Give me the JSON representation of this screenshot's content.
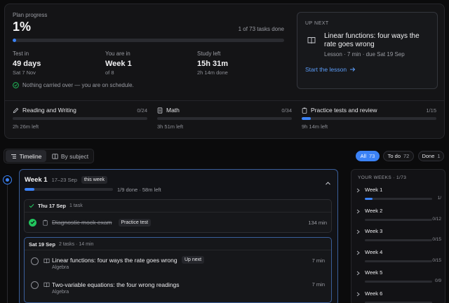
{
  "plan": {
    "label": "Plan progress",
    "percent_text": "1%",
    "tasks_done_text": "1 of 73 tasks done",
    "progress_fraction": 0.014
  },
  "stats": [
    {
      "label": "Test in",
      "value": "49 days",
      "sub": "Sat 7 Nov"
    },
    {
      "label": "You are in",
      "value": "Week 1",
      "sub": "of 8"
    },
    {
      "label": "Study left",
      "value": "15h 31m",
      "sub": "2h 14m done"
    }
  ],
  "schedule_note": "Nothing carried over — you are on schedule.",
  "up_next": {
    "label": "UP NEXT",
    "title": "Linear functions: four ways the rate goes wrong",
    "meta": "Lesson · 7 min · due Sat 19 Sep",
    "cta": "Start the lesson"
  },
  "categories": [
    {
      "name": "Reading and Writing",
      "count": "0/24",
      "left": "2h 26m left",
      "fraction": 0,
      "icon": "pencil-icon"
    },
    {
      "name": "Math",
      "count": "0/34",
      "left": "3h 51m left",
      "fraction": 0,
      "icon": "calculator-icon"
    },
    {
      "name": "Practice tests and review",
      "count": "1/15",
      "left": "9h 14m left",
      "fraction": 0.067,
      "icon": "clipboard-icon"
    }
  ],
  "view_tabs": [
    {
      "label": "Timeline",
      "active": true
    },
    {
      "label": "By subject",
      "active": false
    }
  ],
  "filters": [
    {
      "label": "All",
      "count": "73",
      "active": true
    },
    {
      "label": "To do",
      "count": "72",
      "active": false
    },
    {
      "label": "Done",
      "count": "1",
      "active": false
    }
  ],
  "week": {
    "title": "Week 1",
    "dates": "17–23 Sep",
    "badge": "this week",
    "summary": "1/9 done · 58m left",
    "fraction": 0.11
  },
  "days": [
    {
      "header": "Thu 17 Sep",
      "meta": "1 task",
      "tasks": [
        {
          "title": "Diagnostic mock exam",
          "tag": "Practice test",
          "duration": "134 min",
          "done": true
        }
      ]
    },
    {
      "header": "Sat 19 Sep",
      "meta": "2 tasks · 14 min",
      "tasks": [
        {
          "title": "Linear functions: four ways the rate goes wrong",
          "subject": "Algebra",
          "tag": "Up next",
          "duration": "7 min",
          "done": false
        },
        {
          "title": "Two-variable equations: the four wrong readings",
          "subject": "Algebra",
          "duration": "7 min",
          "done": false
        }
      ]
    }
  ],
  "your_weeks": {
    "label": "YOUR WEEKS · 1/73",
    "items": [
      {
        "name": "Week 1",
        "count": "1/",
        "fraction": 0.11
      },
      {
        "name": "Week 2",
        "count": "0/12",
        "fraction": 0
      },
      {
        "name": "Week 3",
        "count": "0/15",
        "fraction": 0
      },
      {
        "name": "Week 4",
        "count": "0/15",
        "fraction": 0
      },
      {
        "name": "Week 5",
        "count": "0/9",
        "fraction": 0
      },
      {
        "name": "Week 6",
        "count": "",
        "fraction": 0
      }
    ]
  },
  "colors": {
    "accent": "#3b82f6",
    "success": "#22c55e",
    "background": "#0b0b0c"
  }
}
